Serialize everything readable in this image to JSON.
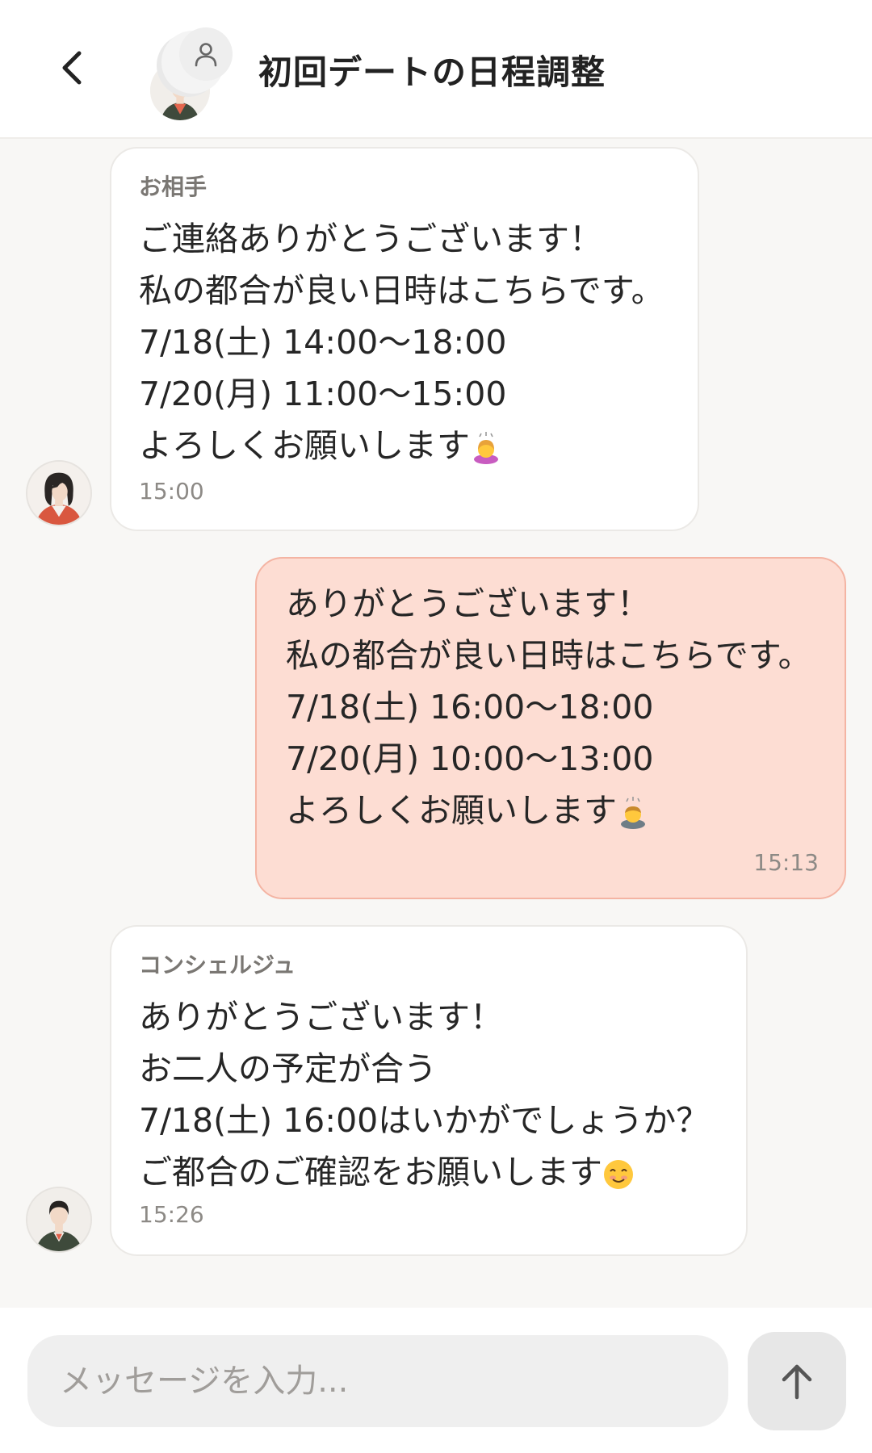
{
  "header": {
    "title": "初回デートの日程調整",
    "back_icon": "chevron-left-icon",
    "participant_icon": "person-icon"
  },
  "messages": [
    {
      "sender": "お相手",
      "direction": "incoming",
      "lines": [
        "ご連絡ありがとうございます！",
        "私の都合が良い日時はこちらです。",
        "7/18(土) 14:00〜18:00",
        "7/20(月) 11:00〜15:00",
        "よろしくお願いします"
      ],
      "emoji": "woman-bowing-emoji",
      "time": "15:00"
    },
    {
      "sender": "",
      "direction": "outgoing",
      "lines": [
        "ありがとうございます！",
        "私の都合が良い日時はこちらです。",
        "7/18(土) 16:00〜18:00",
        "7/20(月) 10:00〜13:00",
        "よろしくお願いします"
      ],
      "emoji": "man-bowing-emoji",
      "time": "15:13"
    },
    {
      "sender": "コンシェルジュ",
      "direction": "incoming",
      "lines": [
        "ありがとうございます！",
        "お二人の予定が合う",
        "7/18(土) 16:00はいかがでしょうか？",
        "ご都合のご確認をお願いします"
      ],
      "emoji": "smiling-face-emoji",
      "time": "15:26"
    }
  ],
  "composer": {
    "placeholder": "メッセージを入力...",
    "send_icon": "arrow-up-icon"
  },
  "colors": {
    "outgoing_bubble": "#fdddd3",
    "outgoing_border": "#f4b4a3",
    "incoming_bubble": "#ffffff",
    "background": "#f8f7f5"
  }
}
